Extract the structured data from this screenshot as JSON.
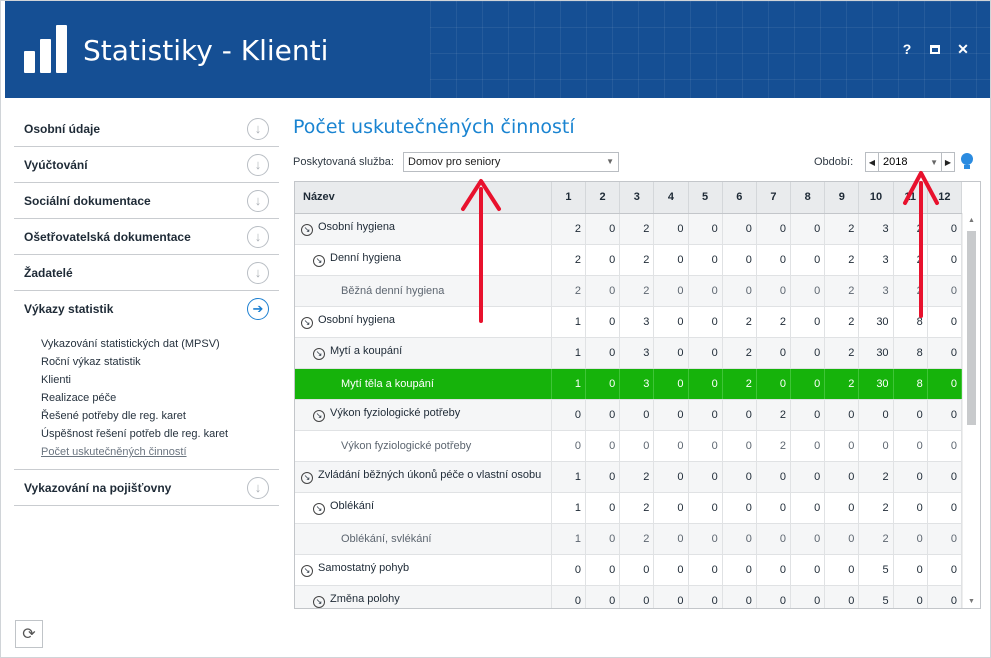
{
  "app": {
    "title": "Statistiky - Klienti",
    "help": "?",
    "close": "✕"
  },
  "sidebar": {
    "items": [
      {
        "label": "Osobní údaje"
      },
      {
        "label": "Vyúčtování"
      },
      {
        "label": "Sociální dokumentace"
      },
      {
        "label": "Ošetřovatelská dokumentace"
      },
      {
        "label": "Žadatelé"
      },
      {
        "label": "Výkazy statistik"
      }
    ],
    "subitems": [
      "Vykazování statistických dat (MPSV)",
      "Roční výkaz statistik",
      "Klienti",
      "Realizace péče",
      "Řešené potřeby dle reg. karet",
      "Úspěšnost řešení potřeb dle reg. karet",
      "Počet uskutečněných činností"
    ],
    "last_item": {
      "label": "Vykazování na pojišťovny"
    }
  },
  "main": {
    "title": "Počet uskutečněných činností",
    "service_label": "Poskytovaná služba:",
    "service_value": "Domov pro seniory",
    "period_label": "Období:",
    "period_value": "2018"
  },
  "grid": {
    "header_name": "Název",
    "months": [
      "1",
      "2",
      "3",
      "4",
      "5",
      "6",
      "7",
      "8",
      "9",
      "10",
      "11",
      "12"
    ],
    "rows": [
      {
        "name": "Osobní hygiena",
        "level": 1,
        "values": [
          "2",
          "0",
          "2",
          "0",
          "0",
          "0",
          "0",
          "0",
          "2",
          "3",
          "2",
          "0"
        ]
      },
      {
        "name": "Denní hygiena",
        "level": 2,
        "values": [
          "2",
          "0",
          "2",
          "0",
          "0",
          "0",
          "0",
          "0",
          "2",
          "3",
          "2",
          "0"
        ]
      },
      {
        "name": "Běžná denní hygiena",
        "level": 3,
        "values": [
          "2",
          "0",
          "2",
          "0",
          "0",
          "0",
          "0",
          "0",
          "2",
          "3",
          "2",
          "0"
        ]
      },
      {
        "name": "Osobní hygiena",
        "level": 1,
        "values": [
          "1",
          "0",
          "3",
          "0",
          "0",
          "2",
          "2",
          "0",
          "2",
          "30",
          "8",
          "0"
        ]
      },
      {
        "name": "Mytí a koupání",
        "level": 2,
        "values": [
          "1",
          "0",
          "3",
          "0",
          "0",
          "2",
          "0",
          "0",
          "2",
          "30",
          "8",
          "0"
        ]
      },
      {
        "name": "Mytí těla a koupání",
        "level": 3,
        "selected": true,
        "values": [
          "1",
          "0",
          "3",
          "0",
          "0",
          "2",
          "0",
          "0",
          "2",
          "30",
          "8",
          "0"
        ]
      },
      {
        "name": "Výkon fyziologické potřeby",
        "level": 2,
        "values": [
          "0",
          "0",
          "0",
          "0",
          "0",
          "0",
          "2",
          "0",
          "0",
          "0",
          "0",
          "0"
        ]
      },
      {
        "name": "Výkon fyziologické potřeby",
        "level": 3,
        "values": [
          "0",
          "0",
          "0",
          "0",
          "0",
          "0",
          "2",
          "0",
          "0",
          "0",
          "0",
          "0"
        ]
      },
      {
        "name": "Zvládání běžných úkonů péče o vlastní osobu",
        "level": 1,
        "values": [
          "1",
          "0",
          "2",
          "0",
          "0",
          "0",
          "0",
          "0",
          "0",
          "2",
          "0",
          "0"
        ]
      },
      {
        "name": "Oblékání",
        "level": 2,
        "values": [
          "1",
          "0",
          "2",
          "0",
          "0",
          "0",
          "0",
          "0",
          "0",
          "2",
          "0",
          "0"
        ]
      },
      {
        "name": "Oblékání, svlékání",
        "level": 3,
        "values": [
          "1",
          "0",
          "2",
          "0",
          "0",
          "0",
          "0",
          "0",
          "0",
          "2",
          "0",
          "0"
        ]
      },
      {
        "name": "Samostatný pohyb",
        "level": 1,
        "values": [
          "0",
          "0",
          "0",
          "0",
          "0",
          "0",
          "0",
          "0",
          "0",
          "5",
          "0",
          "0"
        ]
      },
      {
        "name": "Změna polohy",
        "level": 2,
        "values": [
          "0",
          "0",
          "0",
          "0",
          "0",
          "0",
          "0",
          "0",
          "0",
          "5",
          "0",
          "0"
        ]
      }
    ]
  },
  "colors": {
    "header_bg": "#154f94",
    "accent": "#1a84d1",
    "selected_row": "#16b30b",
    "annotation_arrow": "#e8112d"
  },
  "icons": [
    "bar-chart-logo-icon",
    "expand-circle-icon",
    "arrow-right-circle-icon",
    "refresh-icon",
    "lightbulb-icon",
    "chevron-down-icon"
  ]
}
